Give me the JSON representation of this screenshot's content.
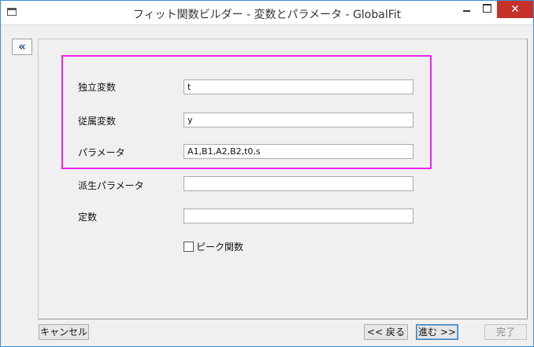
{
  "window": {
    "title": "フィット関数ビルダー - 変数とパラメータ - GlobalFit",
    "close_glyph": "✕"
  },
  "sidebar": {
    "collapse_glyph": "«"
  },
  "form": {
    "independent_vars": {
      "label": "独立変数",
      "value": "t"
    },
    "dependent_vars": {
      "label": "従属変数",
      "value": "y"
    },
    "parameters": {
      "label": "パラメータ",
      "value": "A1,B1,A2,B2,t0,s"
    },
    "derived_parameters": {
      "label": "派生パラメータ",
      "value": ""
    },
    "constants": {
      "label": "定数",
      "value": ""
    },
    "peak_function": {
      "label": "ピーク関数",
      "checked": false
    }
  },
  "footer": {
    "cancel_label": "キャンセル",
    "back_label": "<< 戻る",
    "next_label": "進む >>",
    "finish_label": "完了"
  },
  "colors": {
    "highlight_border": "#ee22ee",
    "close_button": "#c7312a",
    "window_background": "#f0f0f0"
  }
}
